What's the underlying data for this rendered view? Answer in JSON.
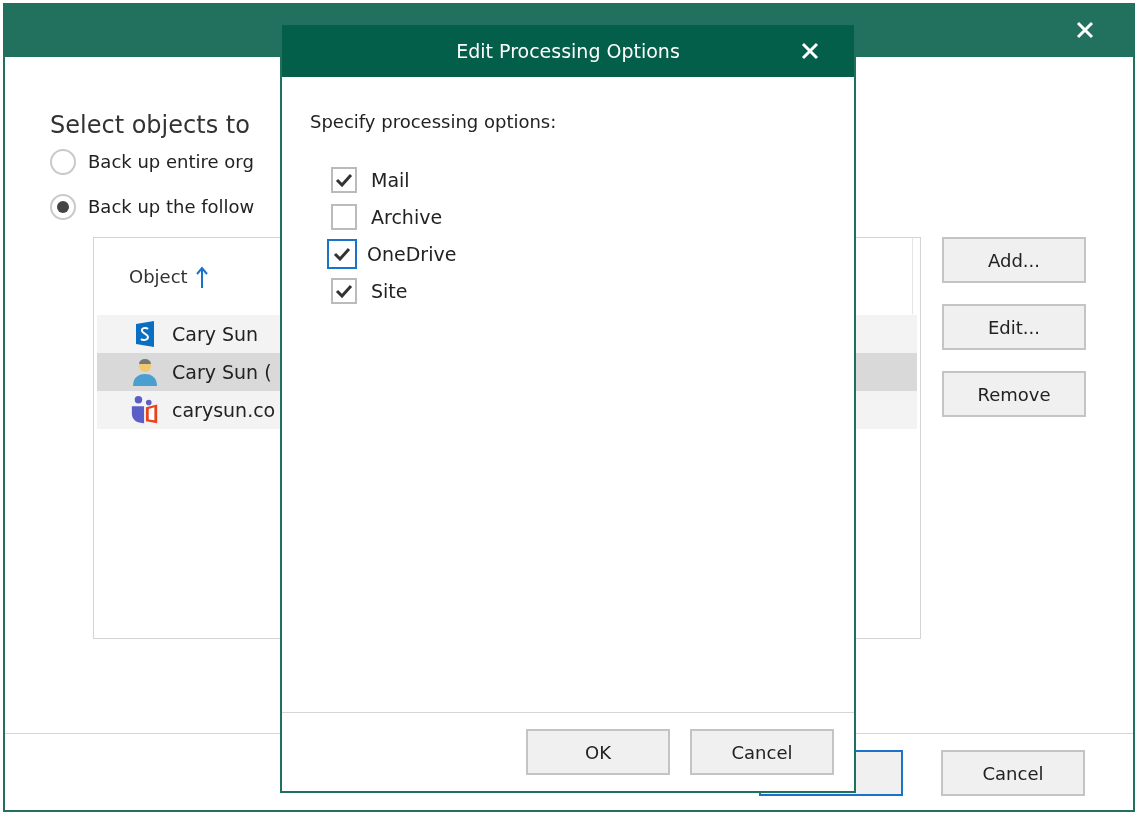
{
  "main_window": {
    "heading": "Select objects to",
    "options": [
      {
        "label": "Back up entire org",
        "selected": false
      },
      {
        "label": "Back up the follow",
        "selected": true
      }
    ],
    "table": {
      "columns": [
        {
          "label": "Object",
          "sort_ascending": true
        }
      ],
      "rows": [
        {
          "kind": "site",
          "name": "Cary Sun",
          "selected": false
        },
        {
          "kind": "user",
          "name": "Cary Sun (",
          "selected": true
        },
        {
          "kind": "organization",
          "name": "carysun.co",
          "selected": false
        }
      ]
    },
    "side_buttons": [
      "Add...",
      "Edit...",
      "Remove"
    ],
    "footer_buttons": [
      "Cancel"
    ]
  },
  "dialog": {
    "title": "Edit Processing Options",
    "prompt": "Specify processing options:",
    "options": [
      {
        "label": "Mail",
        "checked": true,
        "focused": false
      },
      {
        "label": "Archive",
        "checked": false,
        "focused": false
      },
      {
        "label": "OneDrive",
        "checked": true,
        "focused": true
      },
      {
        "label": "Site",
        "checked": true,
        "focused": false
      }
    ],
    "buttons": [
      "OK",
      "Cancel"
    ]
  }
}
